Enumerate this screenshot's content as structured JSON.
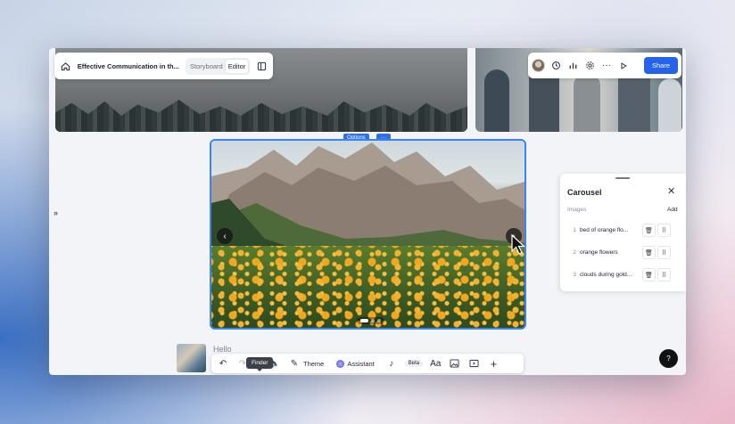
{
  "topbar": {
    "doc_title": "Effective Communication in th...",
    "tabs": [
      {
        "label": "Storyboard",
        "active": false
      },
      {
        "label": "Editor",
        "active": true
      }
    ]
  },
  "toolbar_right": {
    "icons": [
      "avatar",
      "history-icon",
      "chart-icon",
      "gear-icon",
      "more-icon",
      "play-icon"
    ],
    "share_label": "Share"
  },
  "canvas": {
    "options_label": "Options",
    "options_more": "···",
    "carousel": {
      "current_slide": 1,
      "slide_count": 3
    }
  },
  "panel": {
    "title": "Carousel",
    "section_label": "Images",
    "add_label": "Add",
    "items": [
      {
        "num": "1",
        "label": "bed of orange flo..."
      },
      {
        "num": "2",
        "label": "orange flowers"
      },
      {
        "num": "3",
        "label": "clouds during gold..."
      }
    ]
  },
  "bottom": {
    "hello_text": "Hello",
    "theme_label": "Theme",
    "assistant_label": "Assistant",
    "beta_label": "Beta",
    "font_label": "Aa",
    "tooltip": "Finder"
  },
  "help_label": "?",
  "colors": {
    "accent": "#2563eb",
    "selection": "#3b82f6"
  }
}
